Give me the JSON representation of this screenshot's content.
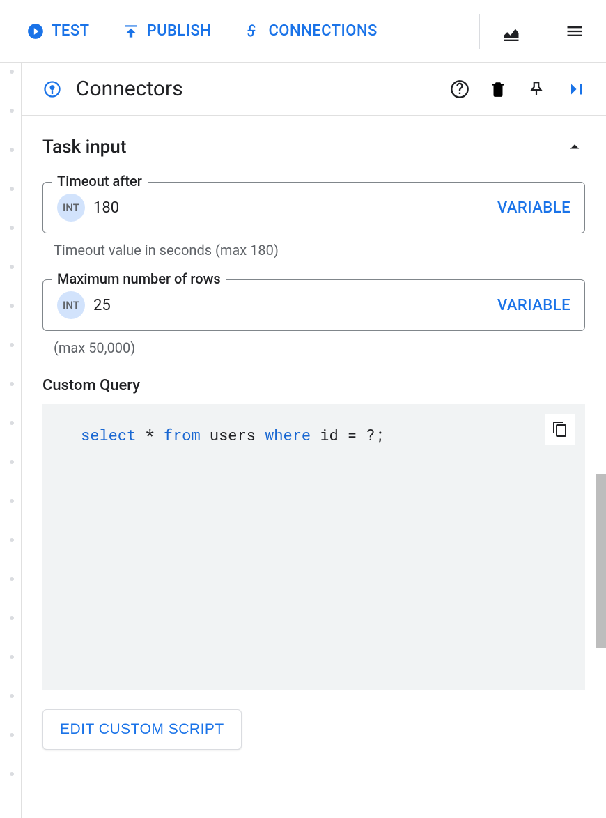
{
  "toolbar": {
    "test_label": "TEST",
    "publish_label": "PUBLISH",
    "connections_label": "CONNECTIONS"
  },
  "panel": {
    "title": "Connectors"
  },
  "task_input": {
    "section_title": "Task input",
    "timeout": {
      "label": "Timeout after",
      "chip": "INT",
      "value": "180",
      "variable_label": "VARIABLE",
      "hint": "Timeout value in seconds (max 180)"
    },
    "max_rows": {
      "label": "Maximum number of rows",
      "chip": "INT",
      "value": "25",
      "variable_label": "VARIABLE",
      "hint": "(max 50,000)"
    },
    "custom_query": {
      "label": "Custom Query",
      "tokens": {
        "select": "select",
        "star": "*",
        "from": "from",
        "table": "users",
        "where": "where",
        "col": "id",
        "rest": " = ?;"
      },
      "edit_label": "EDIT CUSTOM SCRIPT"
    }
  }
}
